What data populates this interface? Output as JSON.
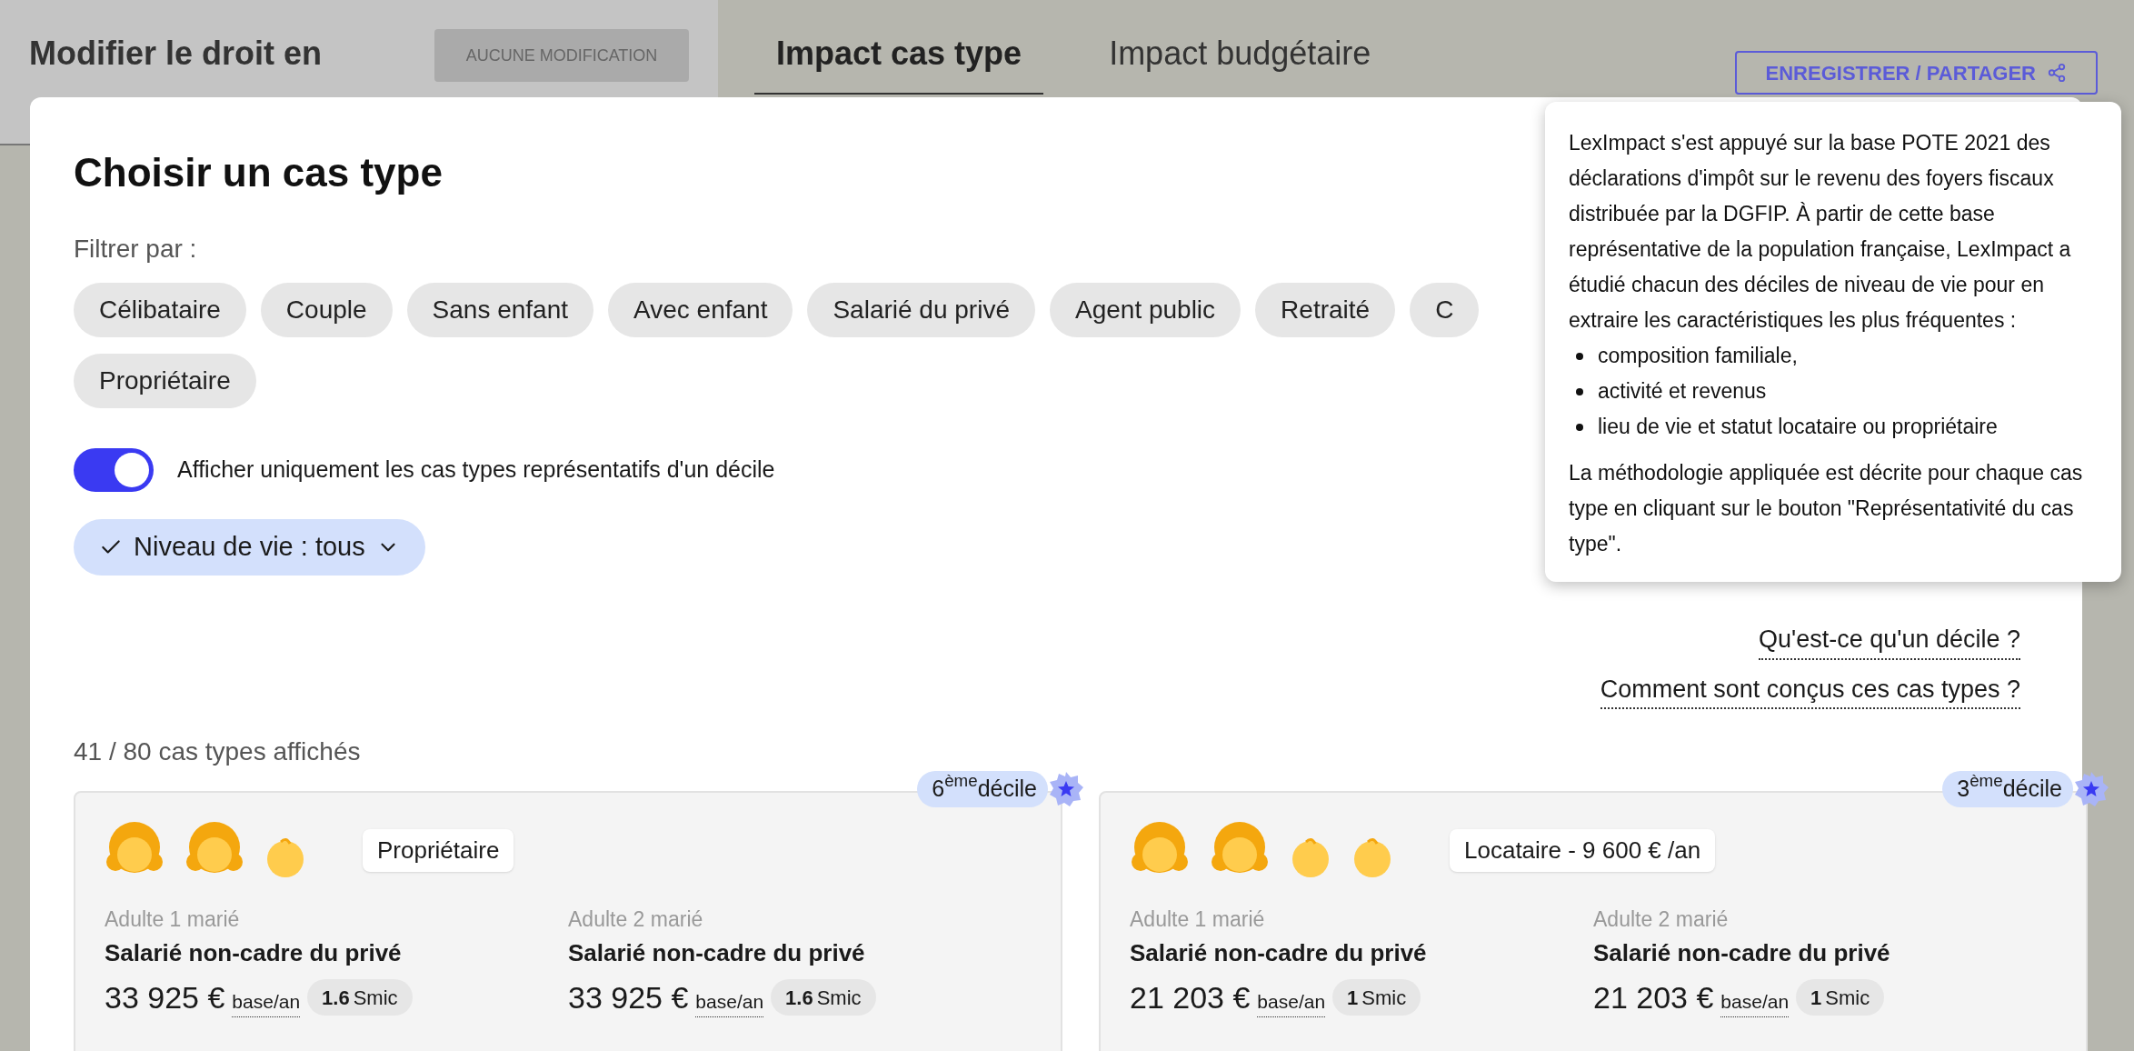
{
  "background": {
    "title": "Modifier le droit en",
    "status_button": "AUCUNE MODIFICATION",
    "tabs": [
      {
        "label": "Impact cas type",
        "selected": true
      },
      {
        "label": "Impact budgétaire",
        "selected": false
      }
    ],
    "save_button": "ENREGISTRER / PARTAGER"
  },
  "modal": {
    "title": "Choisir un cas type",
    "filter_label": "Filtrer par :",
    "filters": [
      "Célibataire",
      "Couple",
      "Sans enfant",
      "Avec enfant",
      "Salarié du privé",
      "Agent public",
      "Retraité",
      "C",
      "Propriétaire"
    ],
    "toggle": {
      "label": "Afficher uniquement les cas types représentatifs d'un décile",
      "on": true
    },
    "dropdown": "Niveau de vie : tous",
    "links": [
      "Qu'est-ce qu'un décile ?",
      "Comment sont conçus ces cas types ?"
    ],
    "count": "41 / 80 cas types affichés",
    "cards": [
      {
        "decile": "6$^{ème}$décile",
        "members": [
          {
            "kind": "adult"
          },
          {
            "kind": "adult"
          },
          {
            "kind": "child"
          }
        ],
        "housing": "Propriétaire",
        "adults": [
          {
            "role": "Adulte 1 marié",
            "status": "Salarié non-cadre du privé",
            "income": "33 925 €",
            "unit": "base/an",
            "smic_value": "1.6",
            "smic_unit": "Smic"
          },
          {
            "role": "Adulte 2 marié",
            "status": "Salarié non-cadre du privé",
            "income": "33 925 €",
            "unit": "base/an",
            "smic_value": "1.6",
            "smic_unit": "Smic"
          }
        ]
      },
      {
        "decile": "3$^{ème}$décile",
        "members": [
          {
            "kind": "adult"
          },
          {
            "kind": "adult"
          },
          {
            "kind": "child"
          },
          {
            "kind": "child"
          }
        ],
        "housing": "Locataire - 9 600 € /an",
        "adults": [
          {
            "role": "Adulte 1 marié",
            "status": "Salarié non-cadre du privé",
            "income": "21 203 €",
            "unit": "base/an",
            "smic_value": "1",
            "smic_unit": "Smic"
          },
          {
            "role": "Adulte 2 marié",
            "status": "Salarié non-cadre du privé",
            "income": "21 203 €",
            "unit": "base/an",
            "smic_value": "1",
            "smic_unit": "Smic"
          }
        ]
      }
    ]
  },
  "tooltip": {
    "intro": "LexImpact s'est appuyé sur la base POTE 2021 des déclarations d'impôt sur le revenu des foyers fiscaux distribuée par la DGFIP. À partir de cette base représentative de la population française, LexImpact a étudié chacun des déciles de niveau de vie pour en extraire les caractéristiques les plus fréquentes :",
    "bullets": [
      "composition familiale,",
      "activité et revenus",
      "lieu de vie et statut locataire ou propriétaire"
    ],
    "closing": "La méthodologie appliquée est décrite pour chaque cas type en cliquant sur le bouton \"Représentativité du cas type\"."
  }
}
